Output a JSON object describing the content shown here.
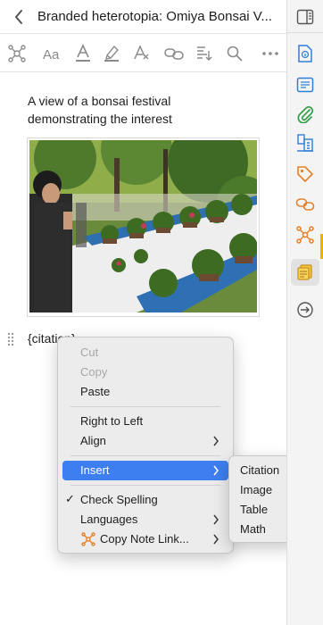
{
  "window": {
    "title": "Branded heterotopia: Omiya Bonsai V..."
  },
  "toolbar": {
    "icons": [
      "network-icon",
      "text-style-icon",
      "text-color-icon",
      "highlight-icon",
      "clear-format-icon",
      "link-icon",
      "note-reference-icon",
      "find-icon",
      "more-icon"
    ]
  },
  "note": {
    "line1": "A view of a bonsai festival",
    "line2": "demonstrating the interest",
    "citation_field": "{citation}"
  },
  "context_menu": {
    "cut": "Cut",
    "copy": "Copy",
    "paste": "Paste",
    "right_to_left": "Right to Left",
    "align": "Align",
    "insert": "Insert",
    "check_spelling": "Check Spelling",
    "check_mark": "✓",
    "languages": "Languages",
    "copy_note_link": "Copy Note Link..."
  },
  "insert_submenu": {
    "citation": "Citation",
    "image": "Image",
    "table": "Table",
    "math": "Math"
  },
  "sidebar": {
    "icons": [
      "toggle-pane-icon",
      "document-info-icon",
      "abstract-icon",
      "attachments-icon",
      "libraries-icon",
      "tags-icon",
      "related-icon",
      "notes-network-icon",
      "notes-icon",
      "locate-icon"
    ]
  },
  "colors": {
    "accent": "#3d7ff0",
    "sidebar_icon": "#2f7fd6",
    "orange": "#e4802a",
    "green": "#34a04a"
  }
}
